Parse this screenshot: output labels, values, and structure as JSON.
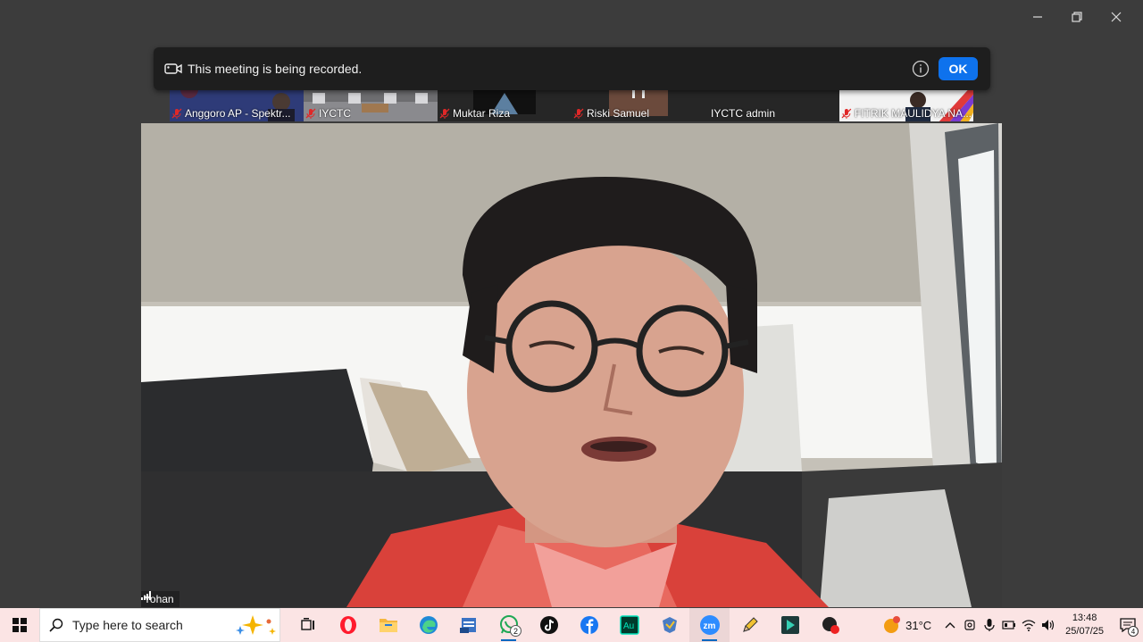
{
  "recording_banner": {
    "message": "This meeting is being recorded.",
    "ok_label": "OK"
  },
  "participants": [
    {
      "name": "Anggoro AP - Spektr...",
      "muted": true
    },
    {
      "name": "IYCTC",
      "muted": true
    },
    {
      "name": "Muktar Riza",
      "muted": true
    },
    {
      "name": "Riski Samuel",
      "muted": true
    },
    {
      "name": "IYCTC admin",
      "muted": false
    },
    {
      "name": "FITRIK MAULIDYA NA...",
      "muted": true
    }
  ],
  "main_video": {
    "speaker_name": "Yohan"
  },
  "taskbar": {
    "search_placeholder": "Type here to search",
    "whatsapp_badge": "2",
    "weather_temp": "31°C",
    "clock_time": "13:48",
    "clock_date": "25/07/25",
    "notification_count": "4"
  },
  "colors": {
    "ok_button": "#0e72ed",
    "taskbar_bg": "#fbe4e4",
    "mute_red": "#e02828"
  }
}
